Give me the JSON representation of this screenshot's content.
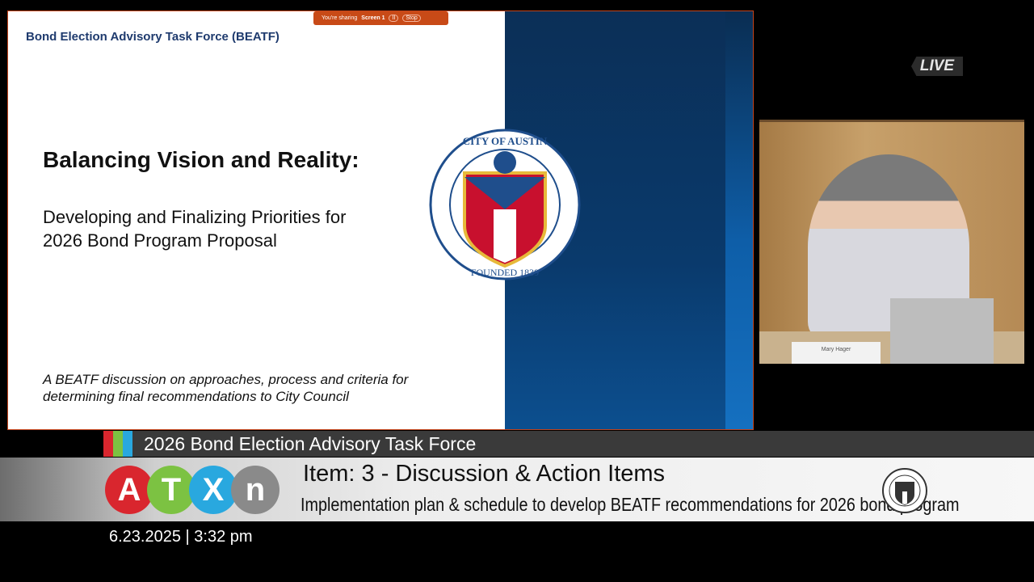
{
  "slide": {
    "org": "Bond Election Advisory Task Force (BEATF)",
    "title": "Balancing Vision and Reality:",
    "subtitle_line1": "Developing and Finalizing Priorities for",
    "subtitle_line2": "2026 Bond Program Proposal",
    "footer_line1": "A BEATF discussion on approaches, process and criteria for",
    "footer_line2": "determining final recommendations to City Council",
    "seal_text": "CITY OF AUSTIN · FOUNDED 1839"
  },
  "share_bar": {
    "label": "You're sharing",
    "target": "Screen 1",
    "stop": "Stop"
  },
  "live": "LIVE",
  "video": {
    "nameplate": "Mary Hager"
  },
  "lower_third": {
    "meeting": "2026 Bond Election Advisory Task Force",
    "item": "Item: 3 - Discussion & Action Items",
    "description": "Implementation plan & schedule to develop BEATF recommendations for 2026 bond program",
    "logo_letters": [
      "A",
      "T",
      "X",
      "N"
    ],
    "datetime": "6.23.2025 | 3:32 pm"
  },
  "colors": {
    "red": "#d9262e",
    "green": "#7cc242",
    "blue": "#29a8df",
    "grey": "#8a8a8a",
    "share": "#c84a17"
  }
}
